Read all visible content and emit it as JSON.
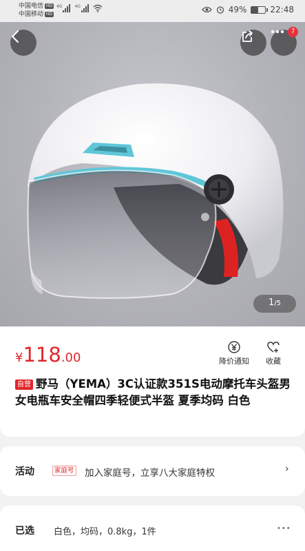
{
  "status_bar": {
    "carrier1": "中国电信",
    "carrier2": "中国移动",
    "hd_badge": "HD",
    "net1": "4G",
    "net2": "4G",
    "battery_text": "49%",
    "battery_level": 0.49,
    "time": "22:48"
  },
  "top_actions": {
    "more_badge": "7"
  },
  "gallery": {
    "current": "1",
    "total": "/5"
  },
  "product": {
    "price_symbol": "¥",
    "price_integer": "118",
    "price_decimal": ".00",
    "notify_label": "降价通知",
    "favorite_label": "收藏",
    "self_tag": "自营",
    "title": "野马（YEMA）3C认证款351S电动摩托车头盔男女电瓶车安全帽四季轻便式半盔 夏季均码 白色"
  },
  "activity": {
    "label": "活动",
    "tag": "家庭号",
    "text": "加入家庭号，立享八大家庭特权",
    "chevron": "›"
  },
  "selected": {
    "label": "已选",
    "text": "白色，均码，0.8kg，1件",
    "more": "•••"
  },
  "colors": {
    "accent": "#e0262b",
    "badge": "#e8313b",
    "helmet_trim": "#5fc6d8"
  }
}
